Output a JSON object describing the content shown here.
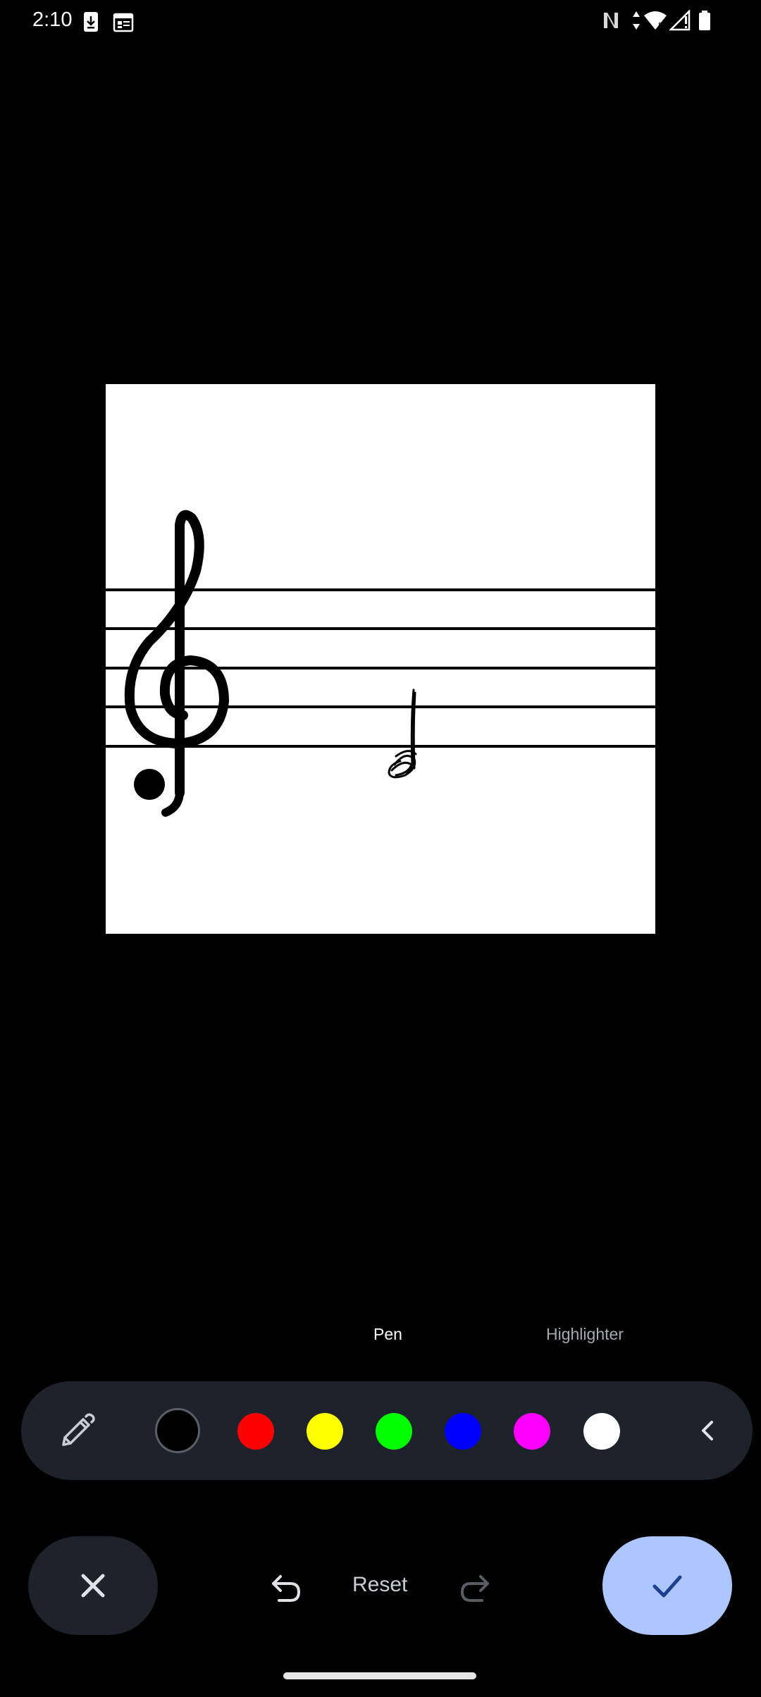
{
  "status_bar": {
    "time": "2:10",
    "left_icons": [
      "download-icon",
      "calendar-icon"
    ],
    "right_icons": [
      "nfc-icon",
      "data-arrows-icon",
      "wifi-icon",
      "signal-icon",
      "battery-icon"
    ]
  },
  "canvas": {
    "content": [
      "treble-clef",
      "five-line-staff",
      "hand-drawn-half-note"
    ]
  },
  "tools": {
    "pen_label": "Pen",
    "highlighter_label": "Highlighter",
    "selected": "Pen"
  },
  "palette": {
    "tool_icon": "pen-icon",
    "colors": [
      {
        "name": "black",
        "hex": "#000000",
        "selected": true
      },
      {
        "name": "red",
        "hex": "#ff0000",
        "selected": false
      },
      {
        "name": "yellow",
        "hex": "#ffff00",
        "selected": false
      },
      {
        "name": "green",
        "hex": "#00ff00",
        "selected": false
      },
      {
        "name": "blue",
        "hex": "#0000ff",
        "selected": false
      },
      {
        "name": "magenta",
        "hex": "#ff00ff",
        "selected": false
      },
      {
        "name": "white",
        "hex": "#ffffff",
        "selected": false
      }
    ],
    "collapse_icon": "chevron-left-icon"
  },
  "actions": {
    "reset_label": "Reset",
    "cancel_icon": "close-icon",
    "confirm_icon": "check-icon",
    "undo_icon": "undo-icon",
    "redo_icon": "redo-icon",
    "redo_enabled": false
  },
  "colors": {
    "background": "#000000",
    "bar_background": "#1e222b",
    "confirm_accent": "#aec6ff",
    "confirm_icon": "#1c3f8f"
  }
}
